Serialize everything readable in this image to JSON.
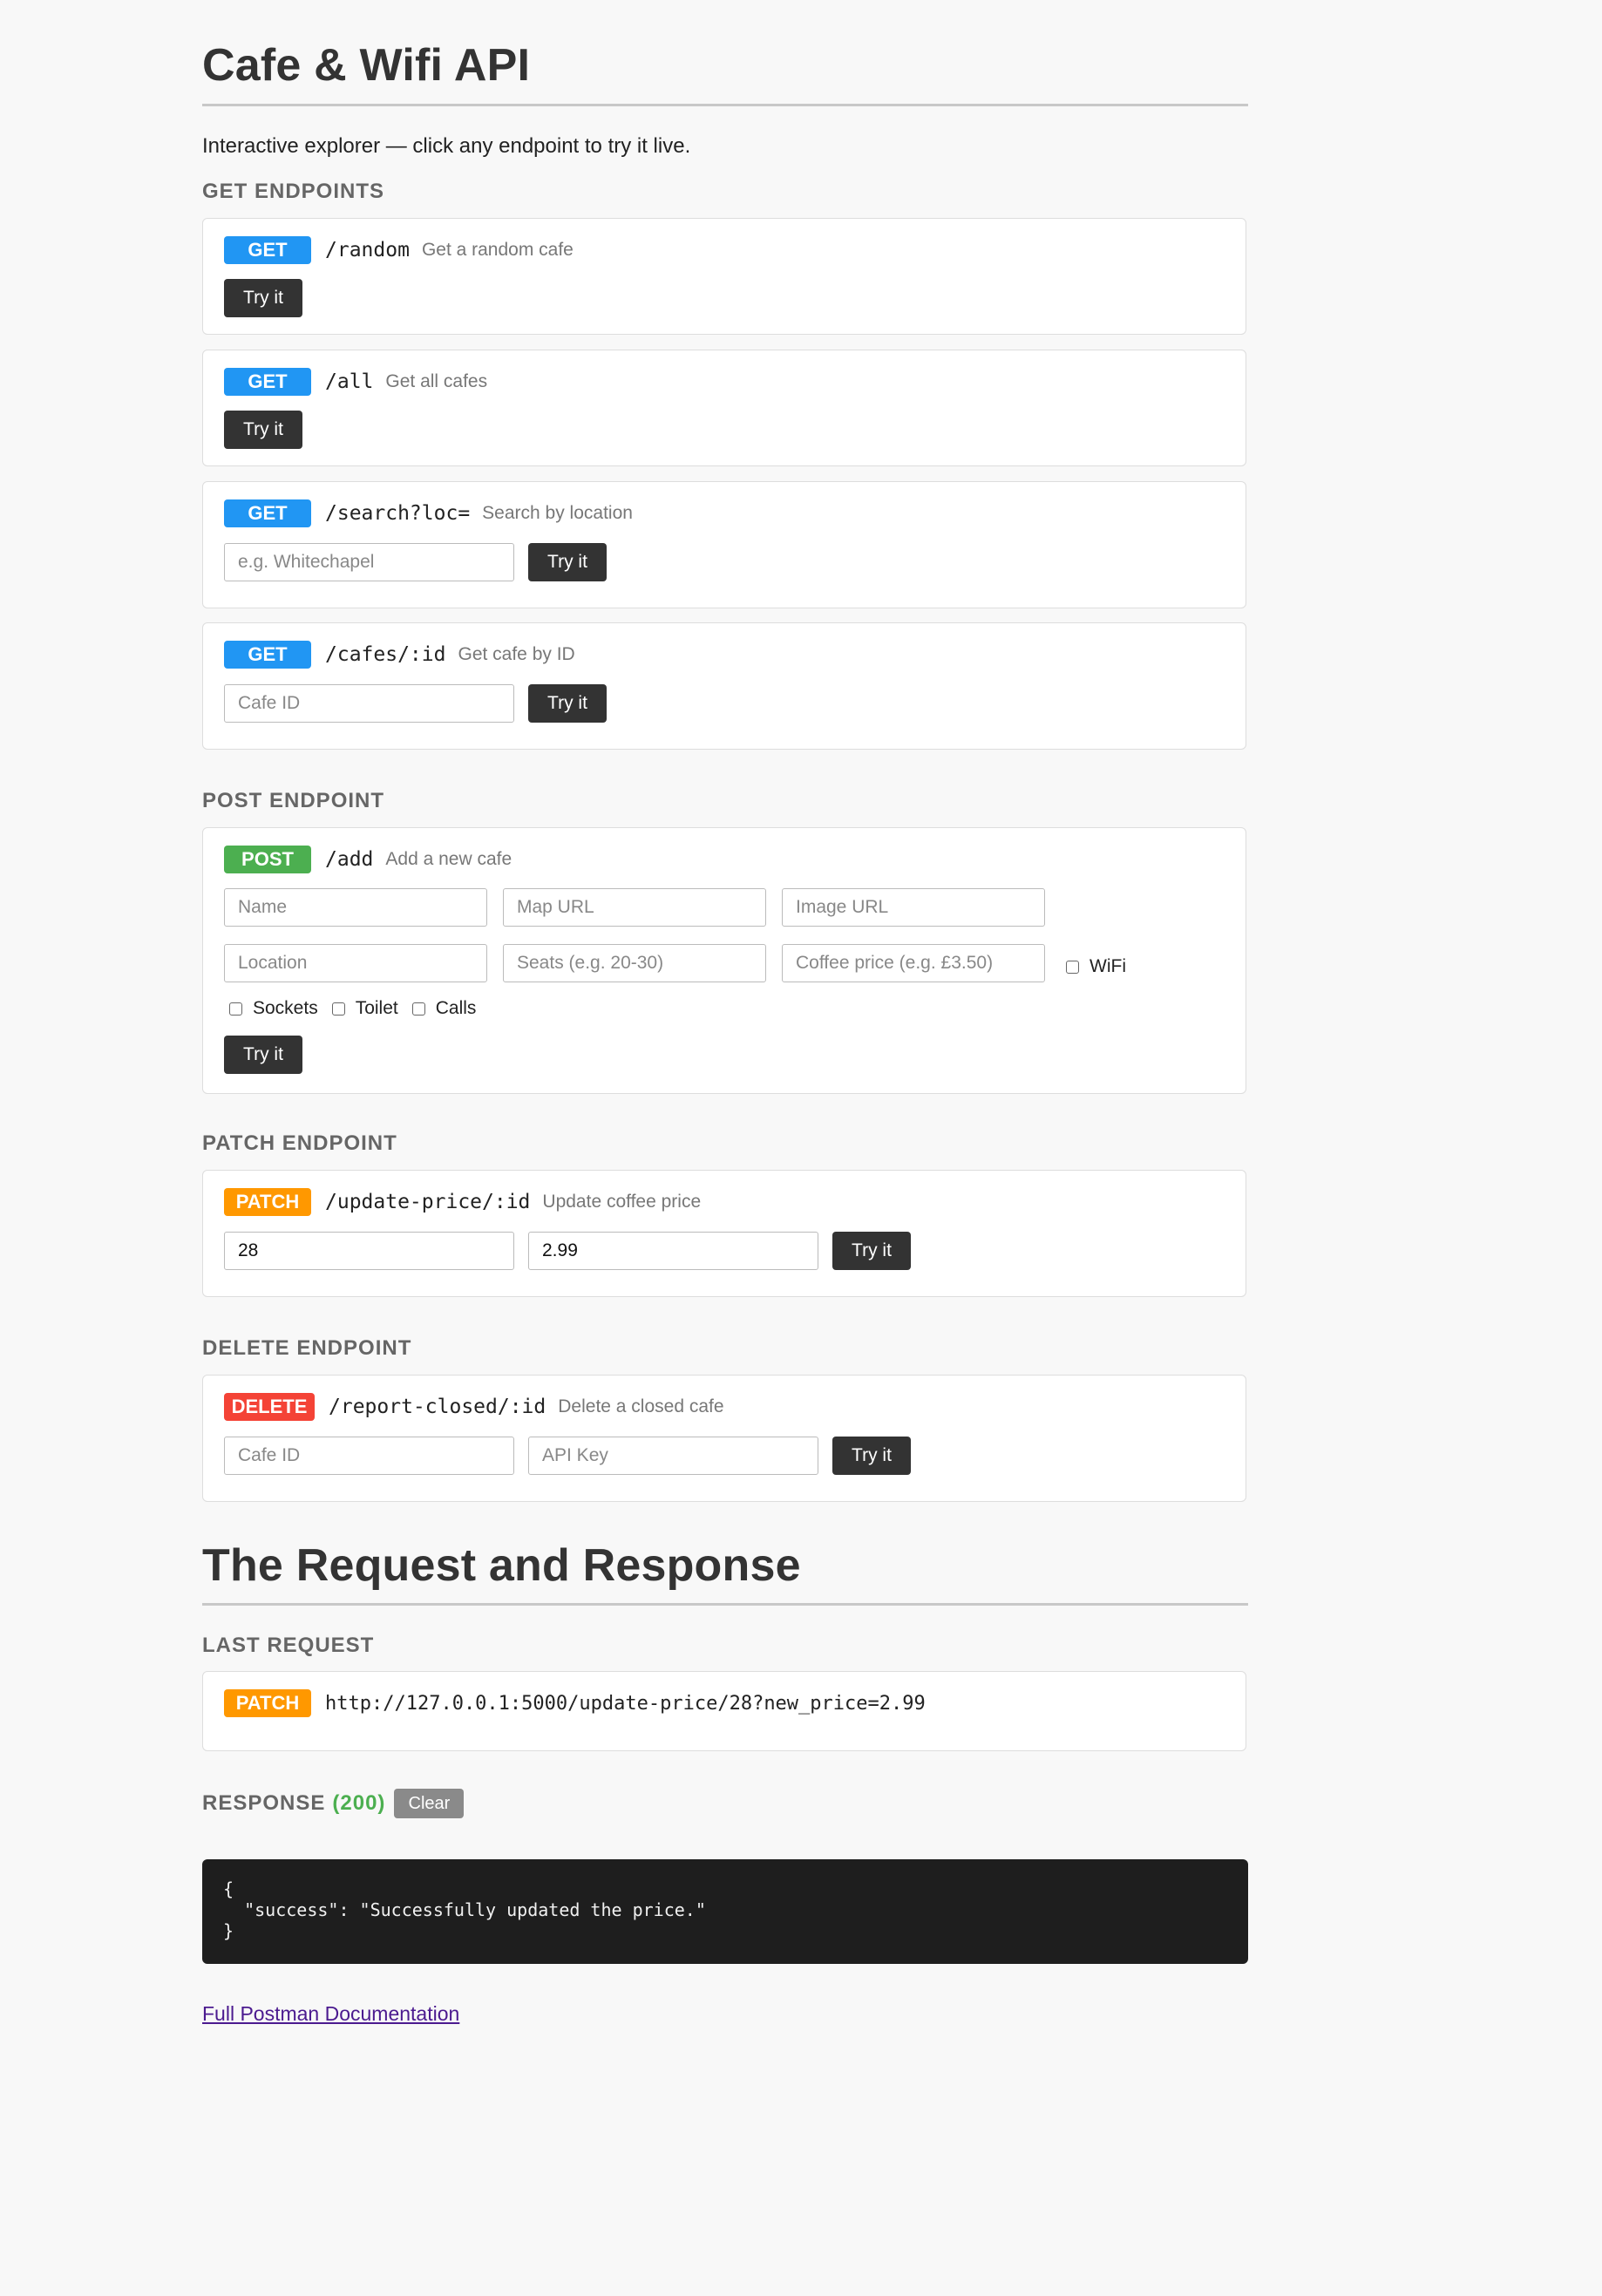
{
  "header": {
    "title": "Cafe & Wifi API",
    "intro": "Interactive explorer — click any endpoint to try it live."
  },
  "sections": {
    "get": "GET ENDPOINTS",
    "post": "POST ENDPOINT",
    "patch": "PATCH ENDPOINT",
    "delete": "DELETE ENDPOINT"
  },
  "try_label": "Try it",
  "get_endpoints": [
    {
      "method": "GET",
      "path": "/random",
      "desc": "Get a random cafe"
    },
    {
      "method": "GET",
      "path": "/all",
      "desc": "Get all cafes"
    },
    {
      "method": "GET",
      "path": "/search?loc=",
      "desc": "Search by location",
      "placeholder": "e.g. Whitechapel"
    },
    {
      "method": "GET",
      "path": "/cafes/:id",
      "desc": "Get cafe by ID",
      "placeholder": "Cafe ID"
    }
  ],
  "post_endpoint": {
    "method": "POST",
    "path": "/add",
    "desc": "Add a new cafe",
    "fields": [
      "Name",
      "Map URL",
      "Image URL",
      "Location",
      "Seats (e.g. 20-30)",
      "Coffee price (e.g. £3.50)"
    ],
    "checkboxes": [
      "WiFi",
      "Sockets",
      "Toilet",
      "Calls"
    ]
  },
  "patch_endpoint": {
    "method": "PATCH",
    "path": "/update-price/:id",
    "desc": "Update coffee price",
    "values": [
      "28",
      "2.99"
    ]
  },
  "delete_endpoint": {
    "method": "DELETE",
    "path": "/report-closed/:id",
    "desc": "Delete a closed cafe",
    "placeholders": [
      "Cafe ID",
      "API Key"
    ]
  },
  "request_response": {
    "title": "The Request and Response",
    "last_request_label": "LAST REQUEST",
    "last_request_method": "PATCH",
    "last_request_url": "http://127.0.0.1:5000/update-price/28?new_price=2.99",
    "response_label": "RESPONSE",
    "status": "(200)",
    "clear_label": "Clear",
    "response_body": "{\n  \"success\": \"Successfully updated the price.\"\n}"
  },
  "footer_link": "Full Postman Documentation",
  "colors": {
    "get": "#2196f3",
    "post": "#4caf50",
    "patch": "#ff9800",
    "delete": "#f44336",
    "status_ok": "#4caf50",
    "button": "#333333"
  }
}
